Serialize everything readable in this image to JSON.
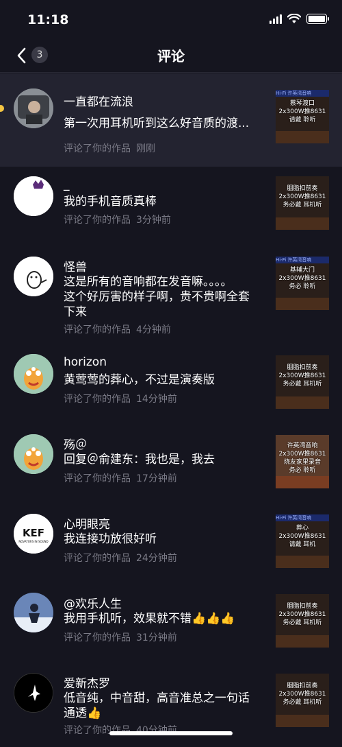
{
  "status": {
    "time": "11:18"
  },
  "header": {
    "title": "评论",
    "badge": "3"
  },
  "comments": [
    {
      "name": "一直都在流浪",
      "lines": [
        "第一次用耳机听到这么好音质的渡..."
      ],
      "meta": "评论了你的作品",
      "time": "刚刚",
      "thumb": {
        "stripe": "Hi-Fi 许英湾音响",
        "caption": [
          "蔡琴渡口",
          "2x300W推8631",
          "请戴  聆听"
        ]
      }
    },
    {
      "name": "_",
      "lines": [
        "我的手机音质真棒"
      ],
      "meta": "评论了你的作品",
      "time": "3分钟前",
      "thumb": {
        "stripe": "",
        "caption": [
          "胭脂扣前奏",
          "2x300W推8631",
          "务必戴  耳机听"
        ]
      }
    },
    {
      "name": "怪兽",
      "lines": [
        "这是所有的音响都在发音嘛。。。。",
        "这个好厉害的样子啊，贵不贵啊全套",
        "下来"
      ],
      "meta": "评论了你的作品",
      "time": "4分钟前",
      "thumb": {
        "stripe": "Hi-Fi 许英湾音响",
        "caption": [
          "基辅大门",
          "2x300W推8631",
          "务必  聆听"
        ]
      }
    },
    {
      "name": "horizon",
      "lines": [
        "黄莺莺的葬心，不过是演奏版"
      ],
      "meta": "评论了你的作品",
      "time": "14分钟前",
      "thumb": {
        "stripe": "",
        "caption": [
          "胭脂扣前奏",
          "2x300W推8631",
          "务必戴  耳机听"
        ]
      }
    },
    {
      "name": "殇＠",
      "lines": [
        "回复＠俞建东：我也是，我去"
      ],
      "meta": "评论了你的作品",
      "time": "17分钟前",
      "thumb": {
        "stripe": "",
        "caption": [
          "许英湾音响",
          "2x300W推8631",
          "烧友家里录音",
          "务必  聆听"
        ]
      }
    },
    {
      "name": "心明眼亮",
      "lines": [
        "我连接功放很好听"
      ],
      "meta": "评论了你的作品",
      "time": "24分钟前",
      "thumb": {
        "stripe": "Hi-Fi 许英湾音响",
        "caption": [
          "葬心",
          "2x300W推8631",
          "请戴  耳机"
        ]
      }
    },
    {
      "name": "@欢乐人生",
      "lines": [
        "我用手机听，效果就不错👍👍👍"
      ],
      "meta": "评论了你的作品",
      "time": "31分钟前",
      "thumb": {
        "stripe": "",
        "caption": [
          "胭脂扣前奏",
          "2x300W推8631",
          "务必戴  耳机听"
        ]
      }
    },
    {
      "name": "爱新杰罗",
      "lines": [
        "低音纯，中音甜，高音准总之一句话",
        "通透👍"
      ],
      "meta": "评论了你的作品",
      "time": "40分钟前",
      "thumb": {
        "stripe": "",
        "caption": [
          "胭脂扣前奏",
          "2x300W推8631",
          "务必戴  耳机听"
        ]
      }
    }
  ]
}
